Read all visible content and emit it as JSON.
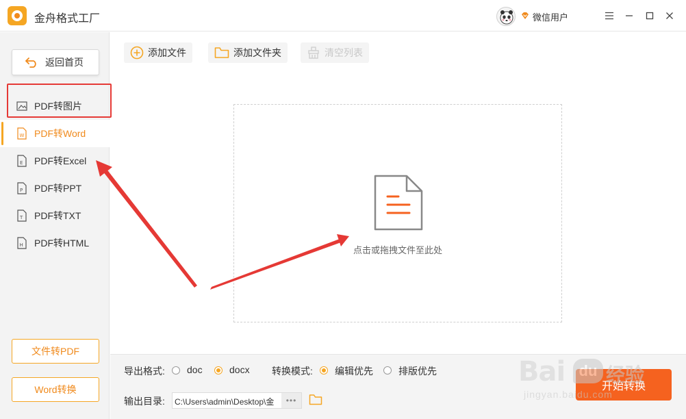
{
  "app": {
    "title": "金舟格式工厂",
    "user_name": "微信用户"
  },
  "sidebar": {
    "back_label": "返回首页",
    "items": [
      {
        "label": "PDF转图片"
      },
      {
        "label": "PDF转Word"
      },
      {
        "label": "PDF转Excel"
      },
      {
        "label": "PDF转PPT"
      },
      {
        "label": "PDF转TXT"
      },
      {
        "label": "PDF转HTML"
      }
    ],
    "bottom_buttons": [
      {
        "label": "文件转PDF"
      },
      {
        "label": "Word转换"
      }
    ]
  },
  "toolbar": {
    "add_file": "添加文件",
    "add_folder": "添加文件夹",
    "clear_list": "清空列表"
  },
  "dropzone": {
    "hint": "点击或拖拽文件至此处"
  },
  "bottom": {
    "format_label": "导出格式:",
    "format_options": [
      {
        "label": "doc",
        "checked": false
      },
      {
        "label": "docx",
        "checked": true
      }
    ],
    "mode_label": "转换模式:",
    "mode_options": [
      {
        "label": "编辑优先",
        "checked": true
      },
      {
        "label": "排版优先",
        "checked": false
      }
    ],
    "output_label": "输出目录:",
    "output_path": "C:\\Users\\admin\\Desktop\\金",
    "more_label": "•••",
    "start_label": "开始转换"
  },
  "watermark": {
    "brand": "Bai",
    "du": "du",
    "jingyan": "经验",
    "url": "jingyan.baidu.com"
  },
  "colors": {
    "accent": "#f5a623",
    "accent_text": "#f08a1c",
    "start": "#f5621f",
    "highlight": "#e53935"
  }
}
